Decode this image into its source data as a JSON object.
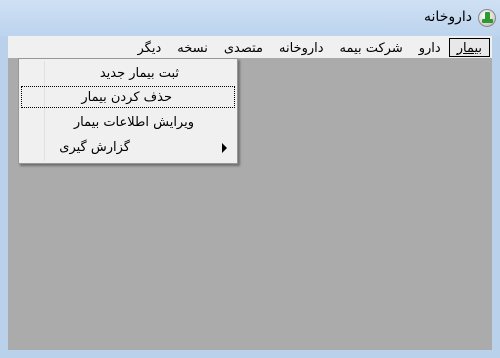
{
  "window": {
    "title": "داروخانه"
  },
  "menubar": {
    "items": [
      {
        "label": "بیمار"
      },
      {
        "label": "دارو"
      },
      {
        "label": "شرکت بیمه"
      },
      {
        "label": "داروخانه"
      },
      {
        "label": "متصدی"
      },
      {
        "label": "نسخه"
      },
      {
        "label": "دیگر"
      }
    ]
  },
  "dropdown": {
    "items": [
      {
        "label": "ثبت بیمار جدید"
      },
      {
        "label": "حذف کردن بیمار"
      },
      {
        "label": "ویرایش اطلاعات بیمار"
      },
      {
        "label": "گزارش گیری"
      }
    ]
  }
}
